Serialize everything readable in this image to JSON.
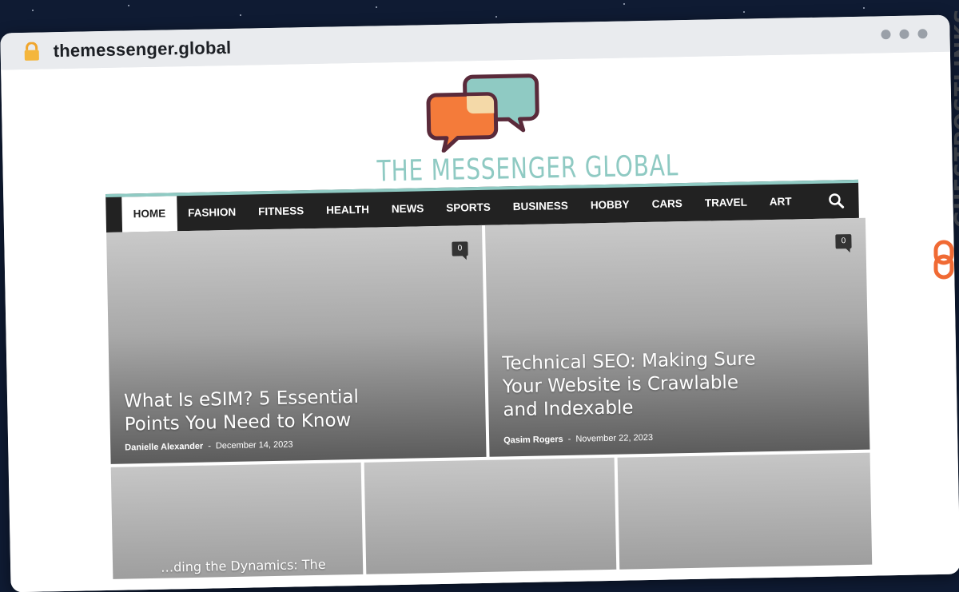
{
  "browser": {
    "url": "themessenger.global"
  },
  "site": {
    "logo_text": "THE MESSENGER GLOBAL",
    "brand_colors": {
      "teal": "#8fcac3",
      "orange": "#f47b3a",
      "outline": "#5a2a3a",
      "nav": "#222222"
    }
  },
  "nav": {
    "items": [
      "HOME",
      "FASHION",
      "FITNESS",
      "HEALTH",
      "NEWS",
      "SPORTS",
      "BUSINESS",
      "HOBBY",
      "CARS",
      "TRAVEL",
      "ART"
    ],
    "active": "HOME",
    "search_icon": "search-icon"
  },
  "featured": [
    {
      "title": "What Is eSIM? 5 Essential Points You Need to Know",
      "author": "Danielle Alexander",
      "date": "December 14, 2023",
      "comments": "0"
    },
    {
      "title": "Technical SEO: Making Sure Your Website is Crawlable and Indexable",
      "author": "Qasim Rogers",
      "date": "November 22, 2023",
      "comments": "0"
    }
  ],
  "second_row": [
    {
      "title": "…ding the Dynamics: The"
    },
    {
      "title": ""
    },
    {
      "title": ""
    }
  ],
  "badge": {
    "text": "GUESTPOSTLINKS"
  }
}
